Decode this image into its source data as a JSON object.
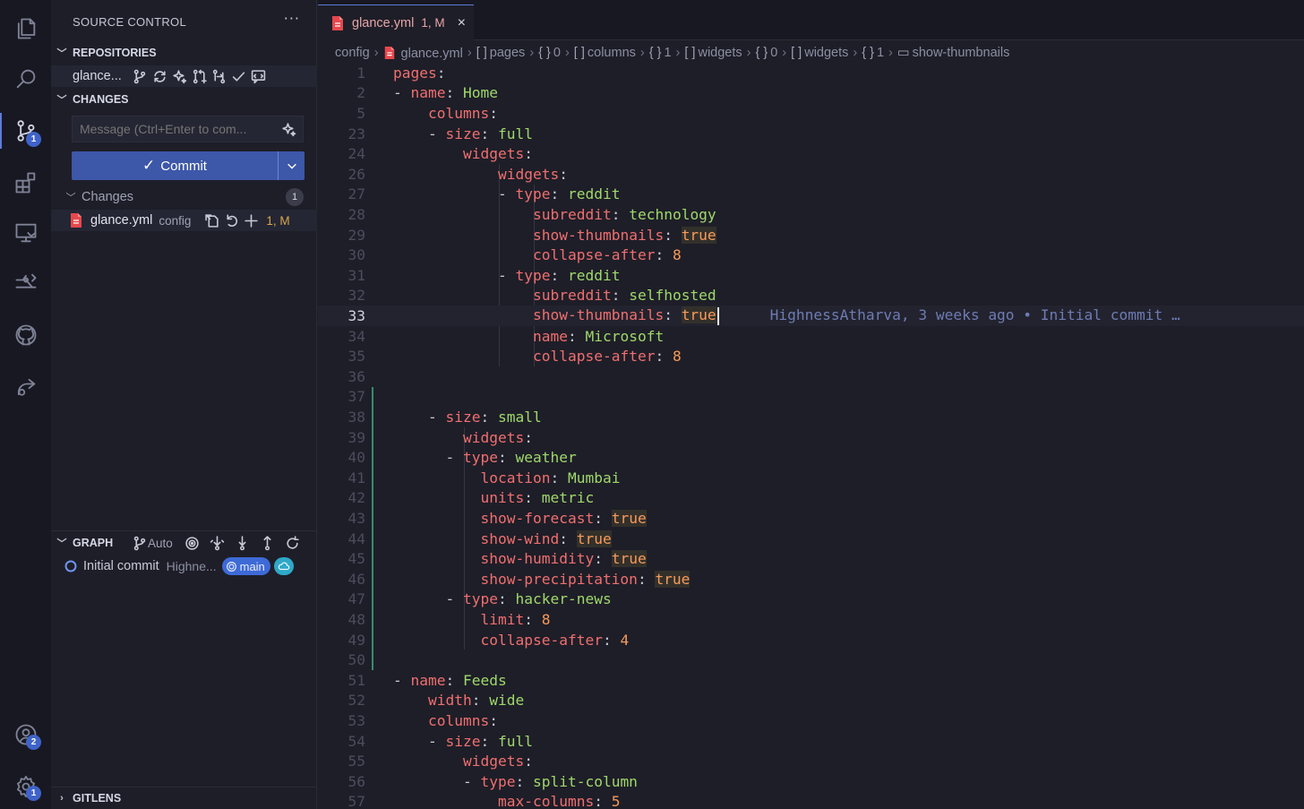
{
  "activity_bar": {
    "items": [
      {
        "name": "explorer",
        "icon": "files-icon"
      },
      {
        "name": "search",
        "icon": "search-icon"
      },
      {
        "name": "source-control",
        "icon": "source-control-icon",
        "badge": "1"
      },
      {
        "name": "extensions",
        "icon": "extensions-icon"
      },
      {
        "name": "remote-explorer",
        "icon": "remote-explorer-icon"
      },
      {
        "name": "gitlens",
        "icon": "gitlens-icon"
      },
      {
        "name": "github",
        "icon": "github-icon"
      },
      {
        "name": "live-share",
        "icon": "live-share-icon"
      }
    ],
    "accounts_badge": "2",
    "settings_badge": "1"
  },
  "sidebar": {
    "title": "SOURCE CONTROL",
    "more": "···",
    "repositories": {
      "header": "REPOSITORIES",
      "repo_name": "glance...",
      "branch_icon_label": "ᵖᵐ"
    },
    "changes": {
      "header": "CHANGES",
      "message_placeholder": "Message (Ctrl+Enter to com...",
      "commit_label": "Commit",
      "commit_check": "✓",
      "group_label": "Changes",
      "group_count": "1",
      "file": {
        "name": "glance.yml",
        "folder": "config",
        "status": "1, M"
      }
    },
    "graph": {
      "header": "GRAPH",
      "auto_label": "Auto",
      "commit_message": "Initial commit",
      "commit_author": "Highne...",
      "branch": "main"
    },
    "gitlens": {
      "header": "GITLENS"
    }
  },
  "editor": {
    "tab": {
      "filename": "glance.yml",
      "status": "1, M",
      "close": "×"
    },
    "breadcrumb": [
      {
        "sym": "",
        "text": "config"
      },
      {
        "sym": "file",
        "text": "glance.yml"
      },
      {
        "sym": "[ ]",
        "text": "pages"
      },
      {
        "sym": "{ }",
        "text": "0"
      },
      {
        "sym": "[ ]",
        "text": "columns"
      },
      {
        "sym": "{ }",
        "text": "1"
      },
      {
        "sym": "[ ]",
        "text": "widgets"
      },
      {
        "sym": "{ }",
        "text": "0"
      },
      {
        "sym": "[ ]",
        "text": "widgets"
      },
      {
        "sym": "{ }",
        "text": "1"
      },
      {
        "sym": "▭",
        "text": "show-thumbnails"
      }
    ],
    "blame": "HighnessAtharva, 3 weeks ago • Initial commit …",
    "lines": [
      {
        "n": "1",
        "indent": 0,
        "key": "pages",
        "val": ""
      },
      {
        "n": "2",
        "indent": 1,
        "dash": true,
        "key": "name",
        "val": "Home",
        "vt": "v"
      },
      {
        "n": "5",
        "indent": 2,
        "key": "columns",
        "val": ""
      },
      {
        "n": "23",
        "indent": 3,
        "dash": true,
        "key": "size",
        "val": "full",
        "vt": "v"
      },
      {
        "n": "24",
        "indent": 4,
        "key": "widgets",
        "val": ""
      },
      {
        "n": "26",
        "indent": 6,
        "key": "widgets",
        "val": ""
      },
      {
        "n": "27",
        "indent": 7,
        "dash": true,
        "key": "type",
        "val": "reddit",
        "vt": "v"
      },
      {
        "n": "28",
        "indent": 8,
        "key": "subreddit",
        "val": "technology",
        "vt": "v"
      },
      {
        "n": "29",
        "indent": 8,
        "key": "show-thumbnails",
        "val": "true",
        "vt": "bool"
      },
      {
        "n": "30",
        "indent": 8,
        "key": "collapse-after",
        "val": "8",
        "vt": "n"
      },
      {
        "n": "31",
        "indent": 7,
        "dash": true,
        "key": "type",
        "val": "reddit",
        "vt": "v"
      },
      {
        "n": "32",
        "indent": 8,
        "key": "subreddit",
        "val": "selfhosted",
        "vt": "v"
      },
      {
        "n": "33",
        "indent": 8,
        "key": "show-thumbnails",
        "val": "true",
        "vt": "bool",
        "current": true
      },
      {
        "n": "34",
        "indent": 8,
        "key": "name",
        "val": "Microsoft",
        "vt": "v"
      },
      {
        "n": "35",
        "indent": 8,
        "key": "collapse-after",
        "val": "8",
        "vt": "n"
      },
      {
        "n": "36",
        "indent": 0,
        "key": "",
        "val": ""
      },
      {
        "n": "37",
        "indent": 0,
        "key": "",
        "val": ""
      },
      {
        "n": "38",
        "indent": 3,
        "dash": true,
        "key": "size",
        "val": "small",
        "vt": "v"
      },
      {
        "n": "39",
        "indent": 4,
        "key": "widgets",
        "val": ""
      },
      {
        "n": "40",
        "indent": 4,
        "dash": true,
        "key": "type",
        "val": "weather",
        "vt": "v"
      },
      {
        "n": "41",
        "indent": 5,
        "key": "location",
        "val": "Mumbai",
        "vt": "v"
      },
      {
        "n": "42",
        "indent": 5,
        "key": "units",
        "val": "metric",
        "vt": "v"
      },
      {
        "n": "43",
        "indent": 5,
        "key": "show-forecast",
        "val": "true",
        "vt": "bool"
      },
      {
        "n": "44",
        "indent": 5,
        "key": "show-wind",
        "val": "true",
        "vt": "bool"
      },
      {
        "n": "45",
        "indent": 5,
        "key": "show-humidity",
        "val": "true",
        "vt": "bool"
      },
      {
        "n": "46",
        "indent": 5,
        "key": "show-precipitation",
        "val": "true",
        "vt": "bool"
      },
      {
        "n": "47",
        "indent": 4,
        "dash": true,
        "key": "type",
        "val": "hacker-news",
        "vt": "v"
      },
      {
        "n": "48",
        "indent": 5,
        "key": "limit",
        "val": "8",
        "vt": "n"
      },
      {
        "n": "49",
        "indent": 5,
        "key": "collapse-after",
        "val": "4",
        "vt": "n"
      },
      {
        "n": "50",
        "indent": 0,
        "key": "",
        "val": ""
      },
      {
        "n": "51",
        "indent": 1,
        "dash": true,
        "key": "name",
        "val": "Feeds",
        "vt": "v"
      },
      {
        "n": "52",
        "indent": 2,
        "key": "width",
        "val": "wide",
        "vt": "v"
      },
      {
        "n": "53",
        "indent": 2,
        "key": "columns",
        "val": ""
      },
      {
        "n": "54",
        "indent": 3,
        "dash": true,
        "key": "size",
        "val": "full",
        "vt": "v"
      },
      {
        "n": "55",
        "indent": 4,
        "key": "widgets",
        "val": ""
      },
      {
        "n": "56",
        "indent": 5,
        "dash": true,
        "key": "type",
        "val": "split-column",
        "vt": "v"
      },
      {
        "n": "57",
        "indent": 6,
        "key": "max-columns",
        "val": "5",
        "vt": "n"
      }
    ]
  },
  "colors": {
    "accent": "#3d57a9",
    "key": "#ef6f6f",
    "string": "#9fd86b",
    "number": "#f79a5a",
    "modified": "#e6a6a6"
  }
}
